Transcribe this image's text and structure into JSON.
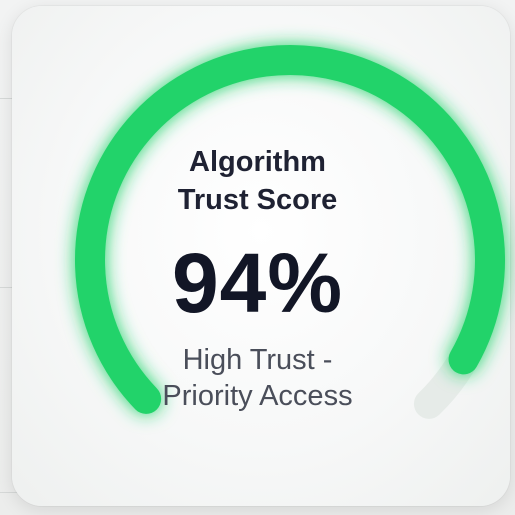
{
  "widget": {
    "title_line1": "Algorithm",
    "title_line2": "Trust Score",
    "value_text": "94%",
    "value": 94,
    "status_line1": "High Trust -",
    "status_line2": "Priority Access"
  },
  "colors": {
    "progress": "#22d36a",
    "progress_glow": "#3ee67e",
    "track": "#e6ebe8",
    "title": "#1f2233",
    "value": "#121626",
    "status": "#4a4e5a"
  }
}
